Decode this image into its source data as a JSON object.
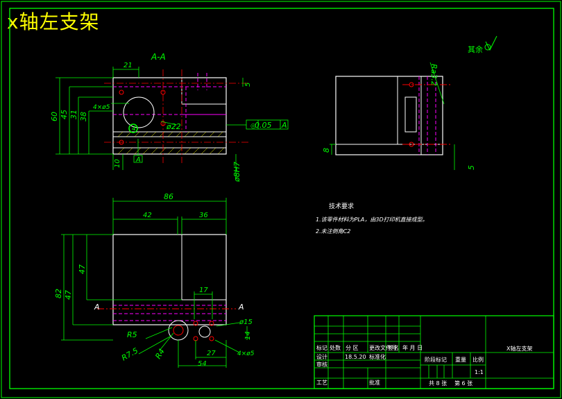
{
  "title": "x轴左支架",
  "colors": {
    "background": "#000000",
    "outline": "#ffffff",
    "dimension": "#00ff00",
    "hidden": "#ff00ff",
    "center": "#ff0000",
    "frame": "#00ff00",
    "title_text": "#ffff00"
  },
  "section_label": "A-A",
  "section_marks": [
    "A",
    "A"
  ],
  "roughness_note": "其余",
  "roughness_top": "Ra3.2",
  "dims_section": {
    "d21": "21",
    "d5": "5",
    "d60": "60",
    "d45": "45",
    "d31": "31",
    "d38": "38",
    "d4phi5": "4×ø5",
    "d4": "4",
    "phi22": "ø22",
    "flatness": "0.05",
    "datum": "A",
    "d10": "10",
    "d8H7": "ø8H7"
  },
  "dims_side": {
    "d8": "8",
    "d5": "5"
  },
  "dims_plan": {
    "d86": "86",
    "d42": "42",
    "d36": "36",
    "d82": "82",
    "d47a": "47",
    "d47b": "47",
    "d17": "17",
    "phi15": "ø15",
    "R5": "R5",
    "R7_5": "R7.5",
    "R4": "R4",
    "d27": "27",
    "d54": "54",
    "d14": "14",
    "d4phi5": "4×ø5"
  },
  "tech_req": {
    "heading": "技术要求",
    "line1": "1.该零件材料为PLA，由3D打印机直接成型。",
    "line2": "2.未注倒角C2"
  },
  "title_block": {
    "part_name": "X轴左支架",
    "r_biaoji": "标记",
    "r_chushu": "处数",
    "r_fenqu": "分 区",
    "r_wenjian": "更改文件号",
    "r_qianming": "签名",
    "r_date": "年 月 日",
    "r_sheji": "设计",
    "r_date_val": "18.5.20",
    "r_biaozhunhua": "标准化",
    "r_shenhe": "审核",
    "r_gongyi": "工艺",
    "r_pizhun": "批准",
    "r_jieduan": "阶段标记",
    "r_zhongliang": "重量",
    "r_bili": "比例",
    "r_scale_val": "1:1",
    "r_zong": "共 8 张",
    "r_di": "第 6 张"
  }
}
